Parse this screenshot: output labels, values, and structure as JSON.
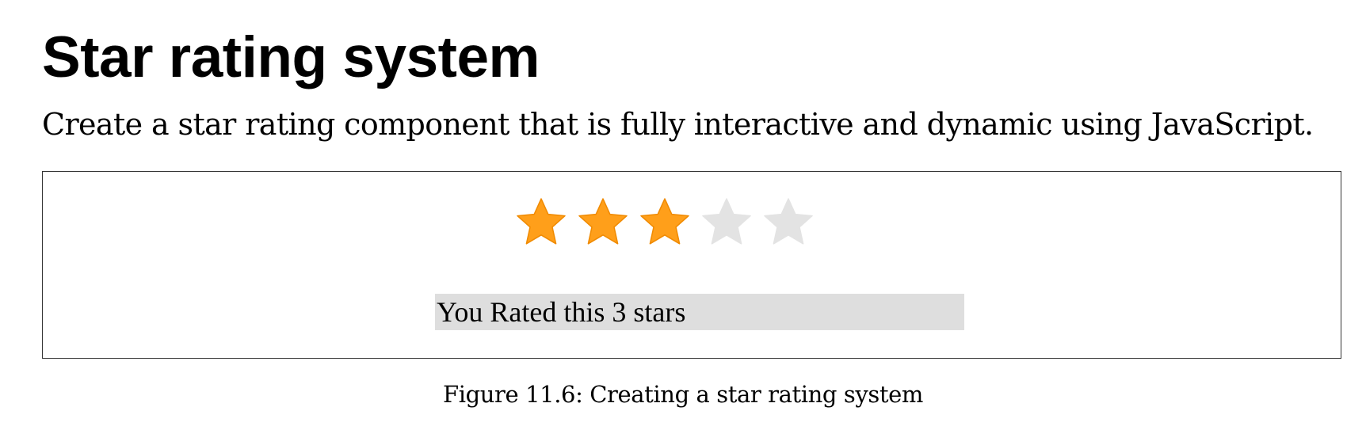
{
  "document": {
    "title": "Star rating system",
    "intro": "Create a star rating component that is fully interactive and dynamic using JavaScript.",
    "caption": "Figure 11.6: Creating a star rating system"
  },
  "rating_widget": {
    "rating": 3,
    "max_stars": 5,
    "result_text": "You Rated this 3 stars",
    "colors": {
      "filled_star": "#ff9f1a",
      "filled_star_edge": "#f08a00",
      "empty_star": "#e3e3e3",
      "result_background": "#dedede"
    },
    "icons": {
      "star": "star-icon"
    }
  }
}
